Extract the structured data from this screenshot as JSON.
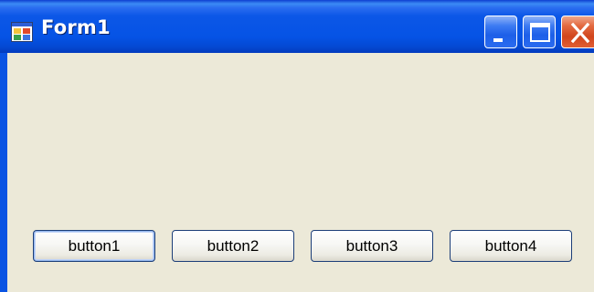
{
  "window": {
    "title": "Form1",
    "icon": "form-app-icon",
    "controls": {
      "minimize_icon": "minimize-icon",
      "maximize_icon": "maximize-icon",
      "close_icon": "close-icon"
    }
  },
  "form": {
    "buttons": [
      {
        "label": "button1",
        "focused": true
      },
      {
        "label": "button2",
        "focused": false
      },
      {
        "label": "button3",
        "focused": false
      },
      {
        "label": "button4",
        "focused": false
      }
    ]
  },
  "colors": {
    "titlebar": "#0553e5",
    "client_background": "#ece9d8",
    "close_button": "#d1451c",
    "button_border": "#1c3e78"
  }
}
